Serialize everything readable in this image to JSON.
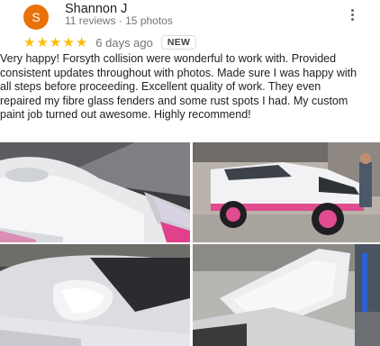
{
  "reviewer": {
    "initial": "S",
    "name": "Shannon J",
    "meta": "11 reviews · 15 photos",
    "avatar_color": "#e8710a"
  },
  "rating": {
    "stars": 5,
    "star_color": "#fbbc04"
  },
  "time": "6 days ago",
  "badge": "NEW",
  "review_text": "Very happy! Forsyth collision were wonderful to work with. Provided consistent updates throughout with photos. Made sure I was happy with all steps before proceeding. Excellent quality of work. They even repaired my fibre glass fenders and some rust spots I had. My custom paint job turned out awesome. Highly recommend!",
  "photos": [
    {
      "icon": "photo-white-truck-front-hood-open"
    },
    {
      "icon": "photo-lifted-white-4runner-pink-wheels"
    },
    {
      "icon": "photo-side-mirror-closeup"
    },
    {
      "icon": "photo-open-hood-in-shop"
    }
  ]
}
